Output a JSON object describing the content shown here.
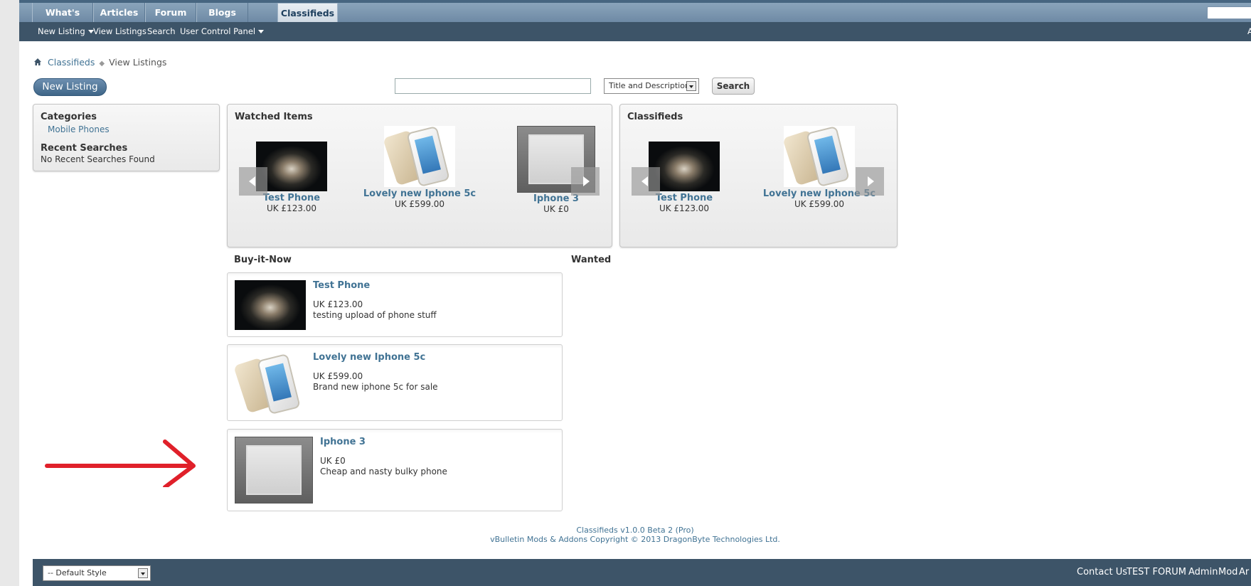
{
  "nav": {
    "tabs": [
      "What's New?",
      "Articles",
      "Forum",
      "Blogs",
      "Classifieds"
    ],
    "active_tab": "Classifieds",
    "subnav": [
      "New Listing",
      "View Listings",
      "Search",
      "User Control Panel"
    ],
    "subnav_right": "Ad"
  },
  "breadcrumb": {
    "items": [
      "Classifieds",
      "View Listings"
    ]
  },
  "actions": {
    "new_listing": "New Listing",
    "search_select": "Title and Descriptions",
    "search_button": "Search"
  },
  "sidebar": {
    "categories_title": "Categories",
    "categories": [
      "Mobile Phones"
    ],
    "recent_title": "Recent Searches",
    "recent_value": "No Recent Searches Found"
  },
  "watched": {
    "title": "Watched Items",
    "items": [
      {
        "title": "Test Phone",
        "price": "UK £123.00"
      },
      {
        "title": "Lovely new Iphone 5c",
        "price": "UK £599.00"
      },
      {
        "title": "Iphone 3",
        "price": "UK £0"
      }
    ]
  },
  "classifieds": {
    "title": "Classifieds",
    "items": [
      {
        "title": "Test Phone",
        "price": "UK £123.00"
      },
      {
        "title": "Lovely new Iphone 5c",
        "price": "UK £599.00"
      }
    ]
  },
  "sections": {
    "buy_it_now": "Buy-it-Now",
    "wanted": "Wanted"
  },
  "listings": [
    {
      "title": "Test Phone",
      "price": "UK £123.00",
      "desc": "testing upload of phone stuff"
    },
    {
      "title": "Lovely new Iphone 5c",
      "price": "UK £599.00",
      "desc": "Brand new iphone 5c for sale"
    },
    {
      "title": "Iphone 3",
      "price": "UK £0",
      "desc": "Cheap and nasty bulky phone"
    }
  ],
  "footer": {
    "version": "Classifieds v1.0.0 Beta 2 (Pro)",
    "copyright": "vBulletin Mods & Addons Copyright © 2013 DragonByte Technologies Ltd.",
    "style_select": "-- Default Style",
    "links": [
      "Contact Us",
      "TEST FORUM",
      "Admin",
      "Mod",
      "Ar"
    ]
  },
  "colors": {
    "accent": "#417394",
    "navbar": "#3d5468",
    "annotation_arrow": "#e0202a"
  }
}
